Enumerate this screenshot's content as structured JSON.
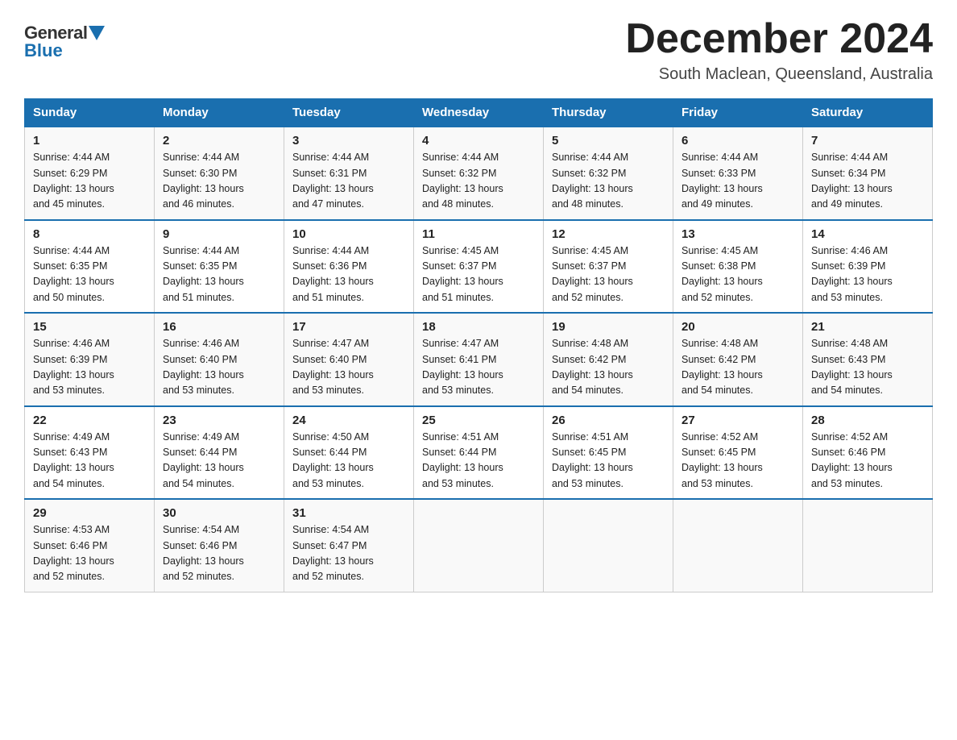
{
  "header": {
    "logo_general": "General",
    "logo_blue": "Blue",
    "month_year": "December 2024",
    "location": "South Maclean, Queensland, Australia"
  },
  "days_of_week": [
    "Sunday",
    "Monday",
    "Tuesday",
    "Wednesday",
    "Thursday",
    "Friday",
    "Saturday"
  ],
  "weeks": [
    [
      {
        "day": 1,
        "info": "Sunrise: 4:44 AM\nSunset: 6:29 PM\nDaylight: 13 hours\nand 45 minutes."
      },
      {
        "day": 2,
        "info": "Sunrise: 4:44 AM\nSunset: 6:30 PM\nDaylight: 13 hours\nand 46 minutes."
      },
      {
        "day": 3,
        "info": "Sunrise: 4:44 AM\nSunset: 6:31 PM\nDaylight: 13 hours\nand 47 minutes."
      },
      {
        "day": 4,
        "info": "Sunrise: 4:44 AM\nSunset: 6:32 PM\nDaylight: 13 hours\nand 48 minutes."
      },
      {
        "day": 5,
        "info": "Sunrise: 4:44 AM\nSunset: 6:32 PM\nDaylight: 13 hours\nand 48 minutes."
      },
      {
        "day": 6,
        "info": "Sunrise: 4:44 AM\nSunset: 6:33 PM\nDaylight: 13 hours\nand 49 minutes."
      },
      {
        "day": 7,
        "info": "Sunrise: 4:44 AM\nSunset: 6:34 PM\nDaylight: 13 hours\nand 49 minutes."
      }
    ],
    [
      {
        "day": 8,
        "info": "Sunrise: 4:44 AM\nSunset: 6:35 PM\nDaylight: 13 hours\nand 50 minutes."
      },
      {
        "day": 9,
        "info": "Sunrise: 4:44 AM\nSunset: 6:35 PM\nDaylight: 13 hours\nand 51 minutes."
      },
      {
        "day": 10,
        "info": "Sunrise: 4:44 AM\nSunset: 6:36 PM\nDaylight: 13 hours\nand 51 minutes."
      },
      {
        "day": 11,
        "info": "Sunrise: 4:45 AM\nSunset: 6:37 PM\nDaylight: 13 hours\nand 51 minutes."
      },
      {
        "day": 12,
        "info": "Sunrise: 4:45 AM\nSunset: 6:37 PM\nDaylight: 13 hours\nand 52 minutes."
      },
      {
        "day": 13,
        "info": "Sunrise: 4:45 AM\nSunset: 6:38 PM\nDaylight: 13 hours\nand 52 minutes."
      },
      {
        "day": 14,
        "info": "Sunrise: 4:46 AM\nSunset: 6:39 PM\nDaylight: 13 hours\nand 53 minutes."
      }
    ],
    [
      {
        "day": 15,
        "info": "Sunrise: 4:46 AM\nSunset: 6:39 PM\nDaylight: 13 hours\nand 53 minutes."
      },
      {
        "day": 16,
        "info": "Sunrise: 4:46 AM\nSunset: 6:40 PM\nDaylight: 13 hours\nand 53 minutes."
      },
      {
        "day": 17,
        "info": "Sunrise: 4:47 AM\nSunset: 6:40 PM\nDaylight: 13 hours\nand 53 minutes."
      },
      {
        "day": 18,
        "info": "Sunrise: 4:47 AM\nSunset: 6:41 PM\nDaylight: 13 hours\nand 53 minutes."
      },
      {
        "day": 19,
        "info": "Sunrise: 4:48 AM\nSunset: 6:42 PM\nDaylight: 13 hours\nand 54 minutes."
      },
      {
        "day": 20,
        "info": "Sunrise: 4:48 AM\nSunset: 6:42 PM\nDaylight: 13 hours\nand 54 minutes."
      },
      {
        "day": 21,
        "info": "Sunrise: 4:48 AM\nSunset: 6:43 PM\nDaylight: 13 hours\nand 54 minutes."
      }
    ],
    [
      {
        "day": 22,
        "info": "Sunrise: 4:49 AM\nSunset: 6:43 PM\nDaylight: 13 hours\nand 54 minutes."
      },
      {
        "day": 23,
        "info": "Sunrise: 4:49 AM\nSunset: 6:44 PM\nDaylight: 13 hours\nand 54 minutes."
      },
      {
        "day": 24,
        "info": "Sunrise: 4:50 AM\nSunset: 6:44 PM\nDaylight: 13 hours\nand 53 minutes."
      },
      {
        "day": 25,
        "info": "Sunrise: 4:51 AM\nSunset: 6:44 PM\nDaylight: 13 hours\nand 53 minutes."
      },
      {
        "day": 26,
        "info": "Sunrise: 4:51 AM\nSunset: 6:45 PM\nDaylight: 13 hours\nand 53 minutes."
      },
      {
        "day": 27,
        "info": "Sunrise: 4:52 AM\nSunset: 6:45 PM\nDaylight: 13 hours\nand 53 minutes."
      },
      {
        "day": 28,
        "info": "Sunrise: 4:52 AM\nSunset: 6:46 PM\nDaylight: 13 hours\nand 53 minutes."
      }
    ],
    [
      {
        "day": 29,
        "info": "Sunrise: 4:53 AM\nSunset: 6:46 PM\nDaylight: 13 hours\nand 52 minutes."
      },
      {
        "day": 30,
        "info": "Sunrise: 4:54 AM\nSunset: 6:46 PM\nDaylight: 13 hours\nand 52 minutes."
      },
      {
        "day": 31,
        "info": "Sunrise: 4:54 AM\nSunset: 6:47 PM\nDaylight: 13 hours\nand 52 minutes."
      },
      null,
      null,
      null,
      null
    ]
  ]
}
